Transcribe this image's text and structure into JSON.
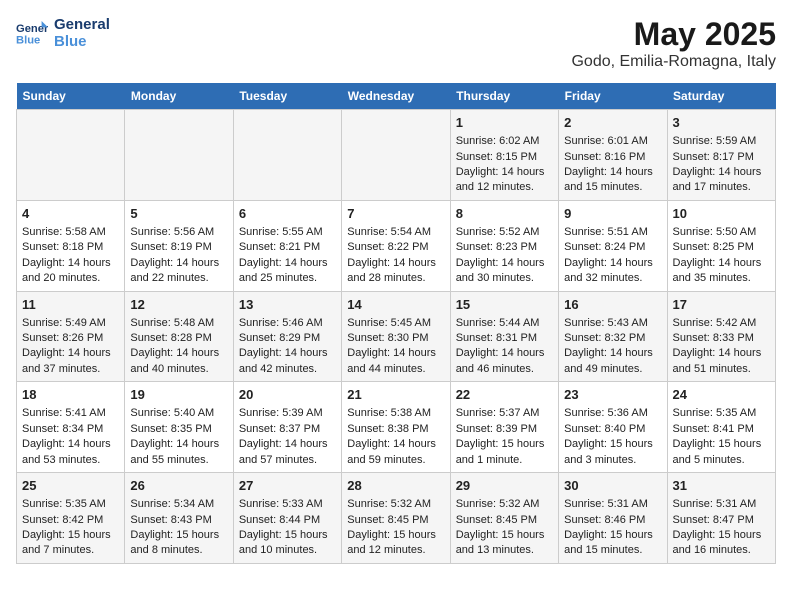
{
  "logo": {
    "line1": "General",
    "line2": "Blue"
  },
  "title": "May 2025",
  "subtitle": "Godo, Emilia-Romagna, Italy",
  "days_of_week": [
    "Sunday",
    "Monday",
    "Tuesday",
    "Wednesday",
    "Thursday",
    "Friday",
    "Saturday"
  ],
  "weeks": [
    [
      {
        "day": "",
        "content": ""
      },
      {
        "day": "",
        "content": ""
      },
      {
        "day": "",
        "content": ""
      },
      {
        "day": "",
        "content": ""
      },
      {
        "day": "1",
        "content": "Sunrise: 6:02 AM\nSunset: 8:15 PM\nDaylight: 14 hours\nand 12 minutes."
      },
      {
        "day": "2",
        "content": "Sunrise: 6:01 AM\nSunset: 8:16 PM\nDaylight: 14 hours\nand 15 minutes."
      },
      {
        "day": "3",
        "content": "Sunrise: 5:59 AM\nSunset: 8:17 PM\nDaylight: 14 hours\nand 17 minutes."
      }
    ],
    [
      {
        "day": "4",
        "content": "Sunrise: 5:58 AM\nSunset: 8:18 PM\nDaylight: 14 hours\nand 20 minutes."
      },
      {
        "day": "5",
        "content": "Sunrise: 5:56 AM\nSunset: 8:19 PM\nDaylight: 14 hours\nand 22 minutes."
      },
      {
        "day": "6",
        "content": "Sunrise: 5:55 AM\nSunset: 8:21 PM\nDaylight: 14 hours\nand 25 minutes."
      },
      {
        "day": "7",
        "content": "Sunrise: 5:54 AM\nSunset: 8:22 PM\nDaylight: 14 hours\nand 28 minutes."
      },
      {
        "day": "8",
        "content": "Sunrise: 5:52 AM\nSunset: 8:23 PM\nDaylight: 14 hours\nand 30 minutes."
      },
      {
        "day": "9",
        "content": "Sunrise: 5:51 AM\nSunset: 8:24 PM\nDaylight: 14 hours\nand 32 minutes."
      },
      {
        "day": "10",
        "content": "Sunrise: 5:50 AM\nSunset: 8:25 PM\nDaylight: 14 hours\nand 35 minutes."
      }
    ],
    [
      {
        "day": "11",
        "content": "Sunrise: 5:49 AM\nSunset: 8:26 PM\nDaylight: 14 hours\nand 37 minutes."
      },
      {
        "day": "12",
        "content": "Sunrise: 5:48 AM\nSunset: 8:28 PM\nDaylight: 14 hours\nand 40 minutes."
      },
      {
        "day": "13",
        "content": "Sunrise: 5:46 AM\nSunset: 8:29 PM\nDaylight: 14 hours\nand 42 minutes."
      },
      {
        "day": "14",
        "content": "Sunrise: 5:45 AM\nSunset: 8:30 PM\nDaylight: 14 hours\nand 44 minutes."
      },
      {
        "day": "15",
        "content": "Sunrise: 5:44 AM\nSunset: 8:31 PM\nDaylight: 14 hours\nand 46 minutes."
      },
      {
        "day": "16",
        "content": "Sunrise: 5:43 AM\nSunset: 8:32 PM\nDaylight: 14 hours\nand 49 minutes."
      },
      {
        "day": "17",
        "content": "Sunrise: 5:42 AM\nSunset: 8:33 PM\nDaylight: 14 hours\nand 51 minutes."
      }
    ],
    [
      {
        "day": "18",
        "content": "Sunrise: 5:41 AM\nSunset: 8:34 PM\nDaylight: 14 hours\nand 53 minutes."
      },
      {
        "day": "19",
        "content": "Sunrise: 5:40 AM\nSunset: 8:35 PM\nDaylight: 14 hours\nand 55 minutes."
      },
      {
        "day": "20",
        "content": "Sunrise: 5:39 AM\nSunset: 8:37 PM\nDaylight: 14 hours\nand 57 minutes."
      },
      {
        "day": "21",
        "content": "Sunrise: 5:38 AM\nSunset: 8:38 PM\nDaylight: 14 hours\nand 59 minutes."
      },
      {
        "day": "22",
        "content": "Sunrise: 5:37 AM\nSunset: 8:39 PM\nDaylight: 15 hours\nand 1 minute."
      },
      {
        "day": "23",
        "content": "Sunrise: 5:36 AM\nSunset: 8:40 PM\nDaylight: 15 hours\nand 3 minutes."
      },
      {
        "day": "24",
        "content": "Sunrise: 5:35 AM\nSunset: 8:41 PM\nDaylight: 15 hours\nand 5 minutes."
      }
    ],
    [
      {
        "day": "25",
        "content": "Sunrise: 5:35 AM\nSunset: 8:42 PM\nDaylight: 15 hours\nand 7 minutes."
      },
      {
        "day": "26",
        "content": "Sunrise: 5:34 AM\nSunset: 8:43 PM\nDaylight: 15 hours\nand 8 minutes."
      },
      {
        "day": "27",
        "content": "Sunrise: 5:33 AM\nSunset: 8:44 PM\nDaylight: 15 hours\nand 10 minutes."
      },
      {
        "day": "28",
        "content": "Sunrise: 5:32 AM\nSunset: 8:45 PM\nDaylight: 15 hours\nand 12 minutes."
      },
      {
        "day": "29",
        "content": "Sunrise: 5:32 AM\nSunset: 8:45 PM\nDaylight: 15 hours\nand 13 minutes."
      },
      {
        "day": "30",
        "content": "Sunrise: 5:31 AM\nSunset: 8:46 PM\nDaylight: 15 hours\nand 15 minutes."
      },
      {
        "day": "31",
        "content": "Sunrise: 5:31 AM\nSunset: 8:47 PM\nDaylight: 15 hours\nand 16 minutes."
      }
    ]
  ]
}
